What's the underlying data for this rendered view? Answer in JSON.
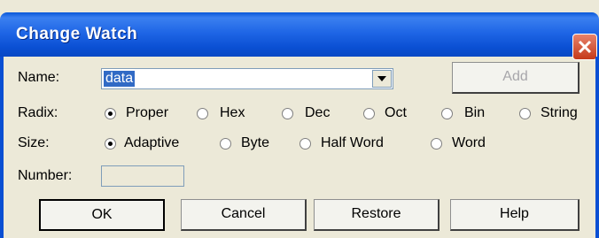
{
  "window": {
    "title": "Change Watch"
  },
  "name_field": {
    "label": "Name:",
    "value": "data"
  },
  "add_button": {
    "label": "Add"
  },
  "radix": {
    "label": "Radix:",
    "options": [
      "Proper",
      "Hex",
      "Dec",
      "Oct",
      "Bin",
      "String"
    ],
    "selected": "Proper"
  },
  "size": {
    "label": "Size:",
    "options": [
      "Adaptive",
      "Byte",
      "Half Word",
      "Word"
    ],
    "selected": "Adaptive"
  },
  "number_field": {
    "label": "Number:",
    "value": ""
  },
  "buttons": {
    "ok": "OK",
    "cancel": "Cancel",
    "restore": "Restore",
    "help": "Help"
  },
  "colors": {
    "title_bar": "#1f66e6",
    "selection": "#316ac5",
    "dialog_bg": "#ece9d8"
  }
}
